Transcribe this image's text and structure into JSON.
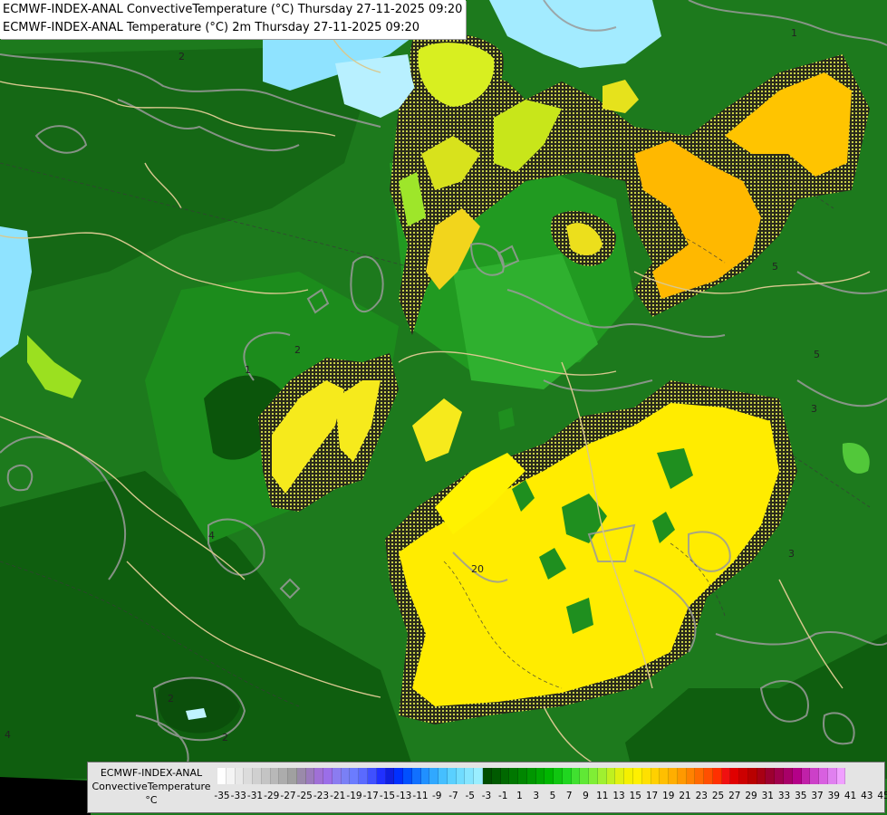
{
  "header": {
    "line1": "ECMWF-INDEX-ANAL ConvectiveTemperature (°C) Thursday 27-11-2025 09:20",
    "line2": "ECMWF-INDEX-ANAL Temperature (°C) 2m Thursday 27-11-2025 09:20"
  },
  "legend": {
    "title_line1": "ECMWF-INDEX-ANAL",
    "title_line2": "ConvectiveTemperature",
    "unit": "°C",
    "tick_labels": [
      "-35",
      "-33",
      "-31",
      "-29",
      "-27",
      "-25",
      "-23",
      "-21",
      "-19",
      "-17",
      "-15",
      "-13",
      "-11",
      "-9",
      "-7",
      "-5",
      "-3",
      "-1",
      "1",
      "3",
      "5",
      "7",
      "9",
      "11",
      "13",
      "15",
      "17",
      "19",
      "21",
      "23",
      "25",
      "27",
      "29",
      "31",
      "33",
      "35",
      "37",
      "39",
      "41",
      "43",
      "45"
    ],
    "colors": [
      "#ffffff",
      "#f4f4f4",
      "#e8e8e8",
      "#dcdcdc",
      "#d0d0d0",
      "#c4c4c4",
      "#b8b8b8",
      "#acacac",
      "#a0a0a0",
      "#9a8aaa",
      "#9b7bbd",
      "#a070d6",
      "#9b6ee8",
      "#8b7cf0",
      "#7a80f5",
      "#6b7cff",
      "#5a6aff",
      "#3f50ff",
      "#2030ff",
      "#1020e0",
      "#0030ff",
      "#0050ff",
      "#1070ff",
      "#2090ff",
      "#30a8ff",
      "#45bfff",
      "#5ad0ff",
      "#70dcff",
      "#85e5ff",
      "#9aeeff",
      "#004d00",
      "#005a00",
      "#006800",
      "#007700",
      "#008600",
      "#009600",
      "#00a600",
      "#00b600",
      "#10c610",
      "#20d620",
      "#40e030",
      "#60e835",
      "#80ee35",
      "#a0f030",
      "#c0f020",
      "#e0f010",
      "#f5f000",
      "#fff000",
      "#ffe000",
      "#ffd000",
      "#ffbf00",
      "#ffae00",
      "#ff9900",
      "#ff8200",
      "#ff6a00",
      "#ff4f00",
      "#ff3000",
      "#f01010",
      "#e00000",
      "#cc0000",
      "#b80000",
      "#a80014",
      "#9c0030",
      "#a0004c",
      "#a80068",
      "#b40088",
      "#c020a8",
      "#cc40c8",
      "#d860e0",
      "#e080f0",
      "#f0a0ff"
    ],
    "accent_colors": {
      "deep_green": "#0a5a0a",
      "mid_green": "#1f8a1f",
      "light_green": "#35b335",
      "yellow": "#ffee00",
      "orange": "#ffb000",
      "light_blue": "#9ee6ff"
    }
  },
  "map_labels": [
    "2",
    "2",
    "1",
    "2",
    "1",
    "5",
    "5",
    "3",
    "4",
    "3",
    "20",
    "2",
    "4"
  ]
}
